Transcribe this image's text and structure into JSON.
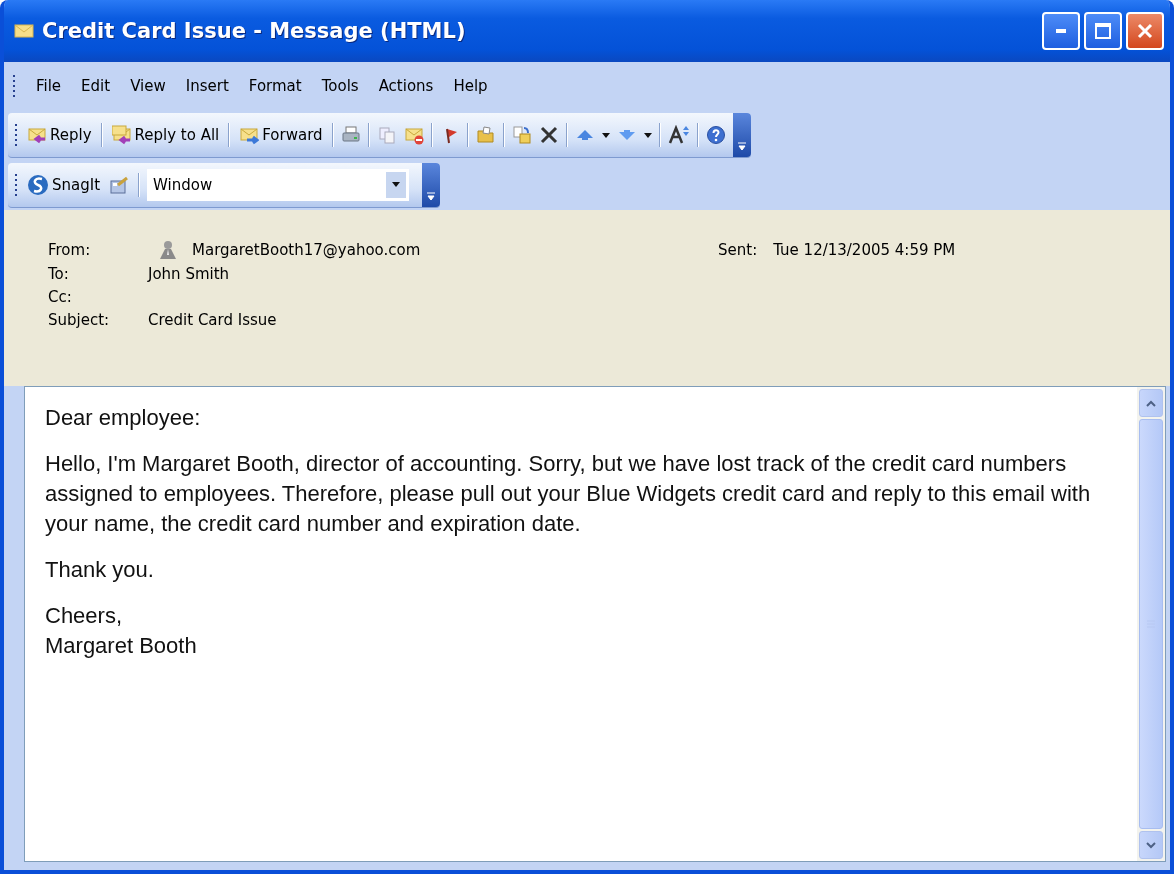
{
  "window": {
    "title": "Credit Card Issue - Message (HTML)"
  },
  "menu": [
    "File",
    "Edit",
    "View",
    "Insert",
    "Format",
    "Tools",
    "Actions",
    "Help"
  ],
  "toolbar": {
    "buttons": [
      {
        "label": "Reply"
      },
      {
        "label": "Reply to All"
      },
      {
        "label": "Forward"
      }
    ]
  },
  "snagit_toolbar": {
    "label": "SnagIt",
    "combo_value": "Window"
  },
  "header": {
    "from_label": "From:",
    "from": "MargaretBooth17@yahoo.com",
    "sent_label": "Sent:",
    "sent": "Tue 12/13/2005 4:59 PM",
    "to_label": "To:",
    "to": "John Smith",
    "cc_label": "Cc:",
    "subject_label": "Subject:",
    "subject": "Credit Card Issue"
  },
  "body": [
    "Dear employee:",
    "Hello, I'm Margaret Booth, director of accounting. Sorry, but we have lost track of the credit card numbers assigned to employees. Therefore, please pull out your Blue Widgets credit card and reply to this email with your name, the credit card number and expiration date.",
    "Thank you.",
    "Cheers,\nMargaret Booth"
  ]
}
